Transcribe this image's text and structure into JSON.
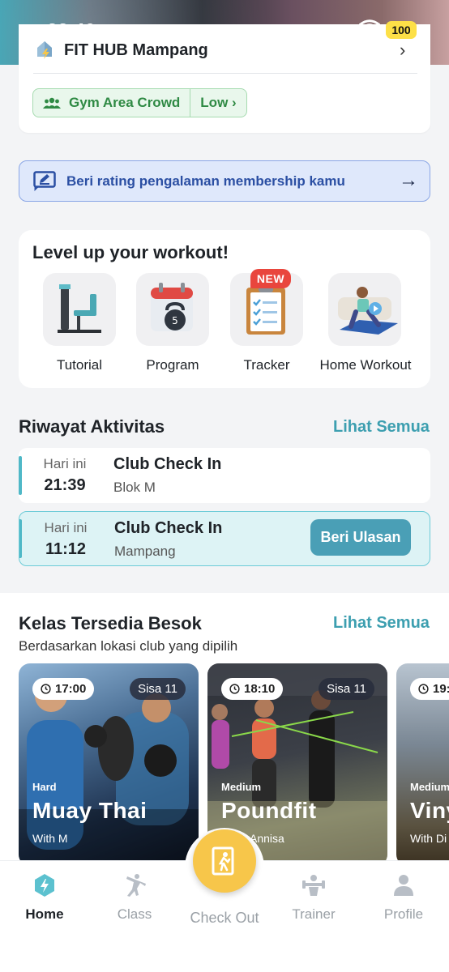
{
  "status": {
    "time": "22.40",
    "battery": "100"
  },
  "gym": {
    "name": "FIT HUB Mampang",
    "crowd_label": "Gym Area Crowd",
    "crowd_level": "Low"
  },
  "rating_banner": {
    "text": "Beri rating pengalaman membership kamu"
  },
  "level_up": {
    "title": "Level up your workout!",
    "new_badge": "NEW",
    "tiles": [
      {
        "label": "Tutorial",
        "icon": "gym-machine-icon"
      },
      {
        "label": "Program",
        "icon": "calendar-kettlebell-icon"
      },
      {
        "label": "Tracker",
        "icon": "clipboard-checklist-icon"
      },
      {
        "label": "Home Workout",
        "icon": "home-workout-icon"
      }
    ]
  },
  "riwayat": {
    "title": "Riwayat Aktivitas",
    "see_all": "Lihat Semua",
    "items": [
      {
        "day": "Hari ini",
        "time": "21:39",
        "title": "Club Check In",
        "location": "Blok M"
      },
      {
        "day": "Hari ini",
        "time": "11:12",
        "title": "Club Check In",
        "location": "Mampang",
        "action": "Beri Ulasan"
      }
    ]
  },
  "kelas": {
    "title": "Kelas Tersedia Besok",
    "see_all": "Lihat Semua",
    "subtitle": "Berdasarkan lokasi club yang dipilih",
    "cards": [
      {
        "time": "17:00",
        "sisa": "Sisa 11",
        "level": "Hard",
        "name": "Muay Thai",
        "with": "With M"
      },
      {
        "time": "18:10",
        "sisa": "Sisa 11",
        "level": "Medium",
        "name": "Poundfit",
        "with": "Annisa"
      },
      {
        "time": "19:",
        "sisa": "",
        "level": "Medium",
        "name": "Viny",
        "with": "With Di"
      }
    ]
  },
  "nav": {
    "items": [
      {
        "label": "Home",
        "icon": "bolt-icon"
      },
      {
        "label": "Class",
        "icon": "martial-arts-icon"
      },
      {
        "label": "Check Out",
        "icon": "exit-door-icon"
      },
      {
        "label": "Trainer",
        "icon": "trainer-icon"
      },
      {
        "label": "Profile",
        "icon": "person-icon"
      }
    ]
  },
  "colors": {
    "accent": "#3d9fb0",
    "crowd_green": "#2f8a44",
    "rating_blue": "#2b4fa3",
    "fab_yellow": "#f7c64a",
    "new_red": "#e9463d"
  }
}
